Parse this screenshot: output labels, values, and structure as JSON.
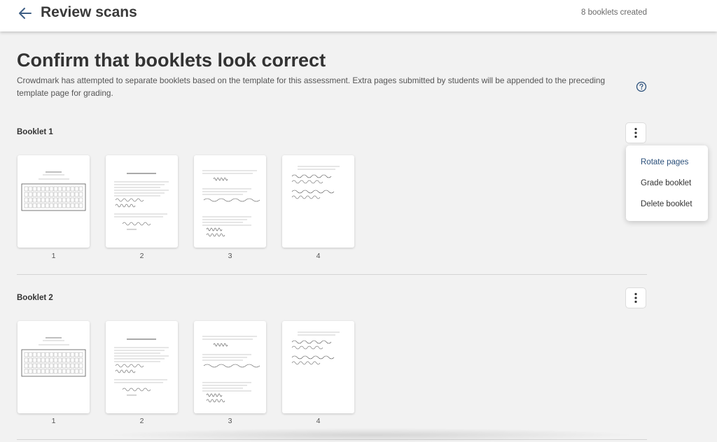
{
  "header": {
    "title": "Review scans",
    "status": "8 booklets created",
    "back_icon": "arrow-left-icon"
  },
  "main": {
    "heading": "Confirm that booklets look correct",
    "description": "Crowdmark has attempted to separate booklets based on the template for this assessment. Extra pages submitted by students will be appended to the preceding template page for grading.",
    "help_icon": "question-circle-icon"
  },
  "booklets": [
    {
      "title": "Booklet 1",
      "pages": [
        {
          "label": "1",
          "kind": "cover"
        },
        {
          "label": "2",
          "kind": "exam-intro"
        },
        {
          "label": "3",
          "kind": "questions"
        },
        {
          "label": "4",
          "kind": "short"
        }
      ]
    },
    {
      "title": "Booklet 2",
      "pages": [
        {
          "label": "1",
          "kind": "cover"
        },
        {
          "label": "2",
          "kind": "exam-intro"
        },
        {
          "label": "3",
          "kind": "questions"
        },
        {
          "label": "4",
          "kind": "short"
        }
      ]
    }
  ],
  "booklet_menu": {
    "items": [
      "Rotate pages",
      "Grade booklet",
      "Delete booklet"
    ],
    "highlighted": "Rotate pages"
  },
  "colors": {
    "accent": "#2a4f7a",
    "background": "#f2f2f2",
    "card": "#ffffff"
  }
}
